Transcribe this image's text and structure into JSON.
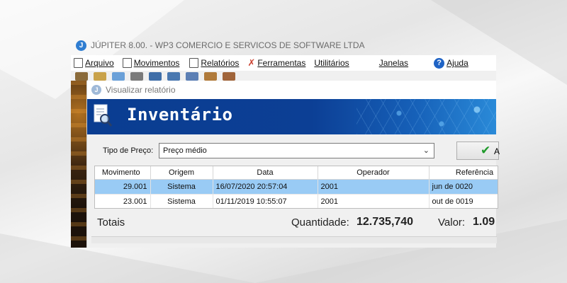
{
  "app": {
    "title": "JÚPITER 8.00. - WP3 COMERCIO E SERVICOS DE SOFTWARE LTDA",
    "logo_letter": "J"
  },
  "menu": {
    "items": [
      {
        "label": "Arquivo",
        "icon": "document-icon"
      },
      {
        "label": "Movimentos",
        "icon": "document-icon"
      },
      {
        "label": "Relatórios",
        "icon": "report-icon"
      },
      {
        "label": "Ferramentas",
        "icon": "tools-icon"
      },
      {
        "label": "Utilitários",
        "icon": ""
      },
      {
        "label": "Janelas",
        "icon": ""
      },
      {
        "label": "Ajuda",
        "icon": "help-icon"
      }
    ]
  },
  "report_window": {
    "title": "Visualizar relatório",
    "banner_title": "Inventário"
  },
  "filter": {
    "label": "Tipo de Preço:",
    "value": "Preço médio",
    "button_label": "A"
  },
  "table": {
    "columns": [
      "Movimento",
      "Origem",
      "Data",
      "Operador",
      "Referência"
    ],
    "rows": [
      {
        "movimento": "29.001",
        "origem": "Sistema",
        "data": "16/07/2020 20:57:04",
        "operador": "2001",
        "referencia": "jun de 0020",
        "selected": true
      },
      {
        "movimento": "23.001",
        "origem": "Sistema",
        "data": "01/11/2019 10:55:07",
        "operador": "2001",
        "referencia": "out de 0019",
        "selected": false
      }
    ]
  },
  "totals": {
    "label": "Totais",
    "quantidade_label": "Quantidade:",
    "quantidade_value": "12.735,740",
    "valor_label": "Valor:",
    "valor_value": "1.09"
  },
  "colors": {
    "banner": "#0a3d91",
    "selected_row": "#99cbf5",
    "accept_green": "#1e9a2a"
  }
}
